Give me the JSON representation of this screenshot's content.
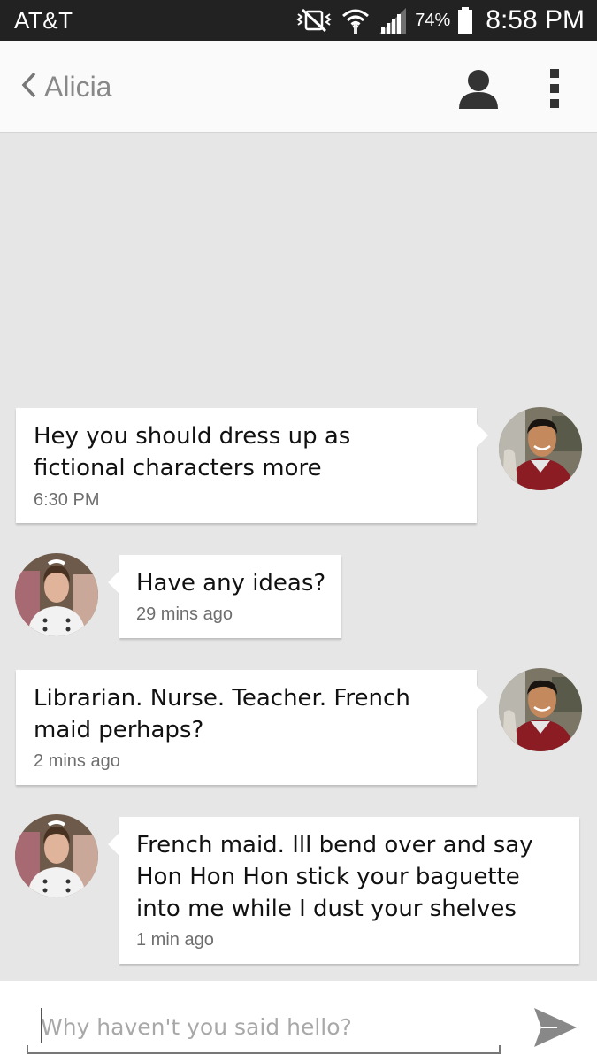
{
  "status_bar": {
    "carrier": "AT&T",
    "battery_percent": "74%",
    "time": "8:58 PM",
    "icons": [
      "vibrate-off-icon",
      "wifi-icon",
      "signal-icon",
      "battery-icon"
    ]
  },
  "header": {
    "contact_name": "Alicia",
    "back_icon": "chevron-left-icon",
    "profile_icon": "person-icon",
    "menu_icon": "more-vertical-icon"
  },
  "messages": [
    {
      "direction": "outgoing",
      "text": "Hey you should dress up as\nfictional characters more",
      "time": "6:30 PM"
    },
    {
      "direction": "incoming",
      "text": "Have any ideas?",
      "time": "29 mins ago"
    },
    {
      "direction": "outgoing",
      "text": "Librarian. Nurse.  Teacher. French\nmaid perhaps?",
      "time": "2 mins ago"
    },
    {
      "direction": "incoming",
      "text": "French maid. Ill bend over and say\nHon Hon Hon stick your baguette\ninto me while I dust your shelves",
      "time": "1 min ago"
    }
  ],
  "composer": {
    "placeholder": "Why haven't you said hello?",
    "value": "",
    "send_icon": "send-icon"
  },
  "colors": {
    "status_bar_bg": "#222222",
    "app_bar_bg": "#fafafa",
    "chat_bg": "#e6e6e6",
    "bubble_bg": "#ffffff",
    "contact_name": "#888888"
  }
}
